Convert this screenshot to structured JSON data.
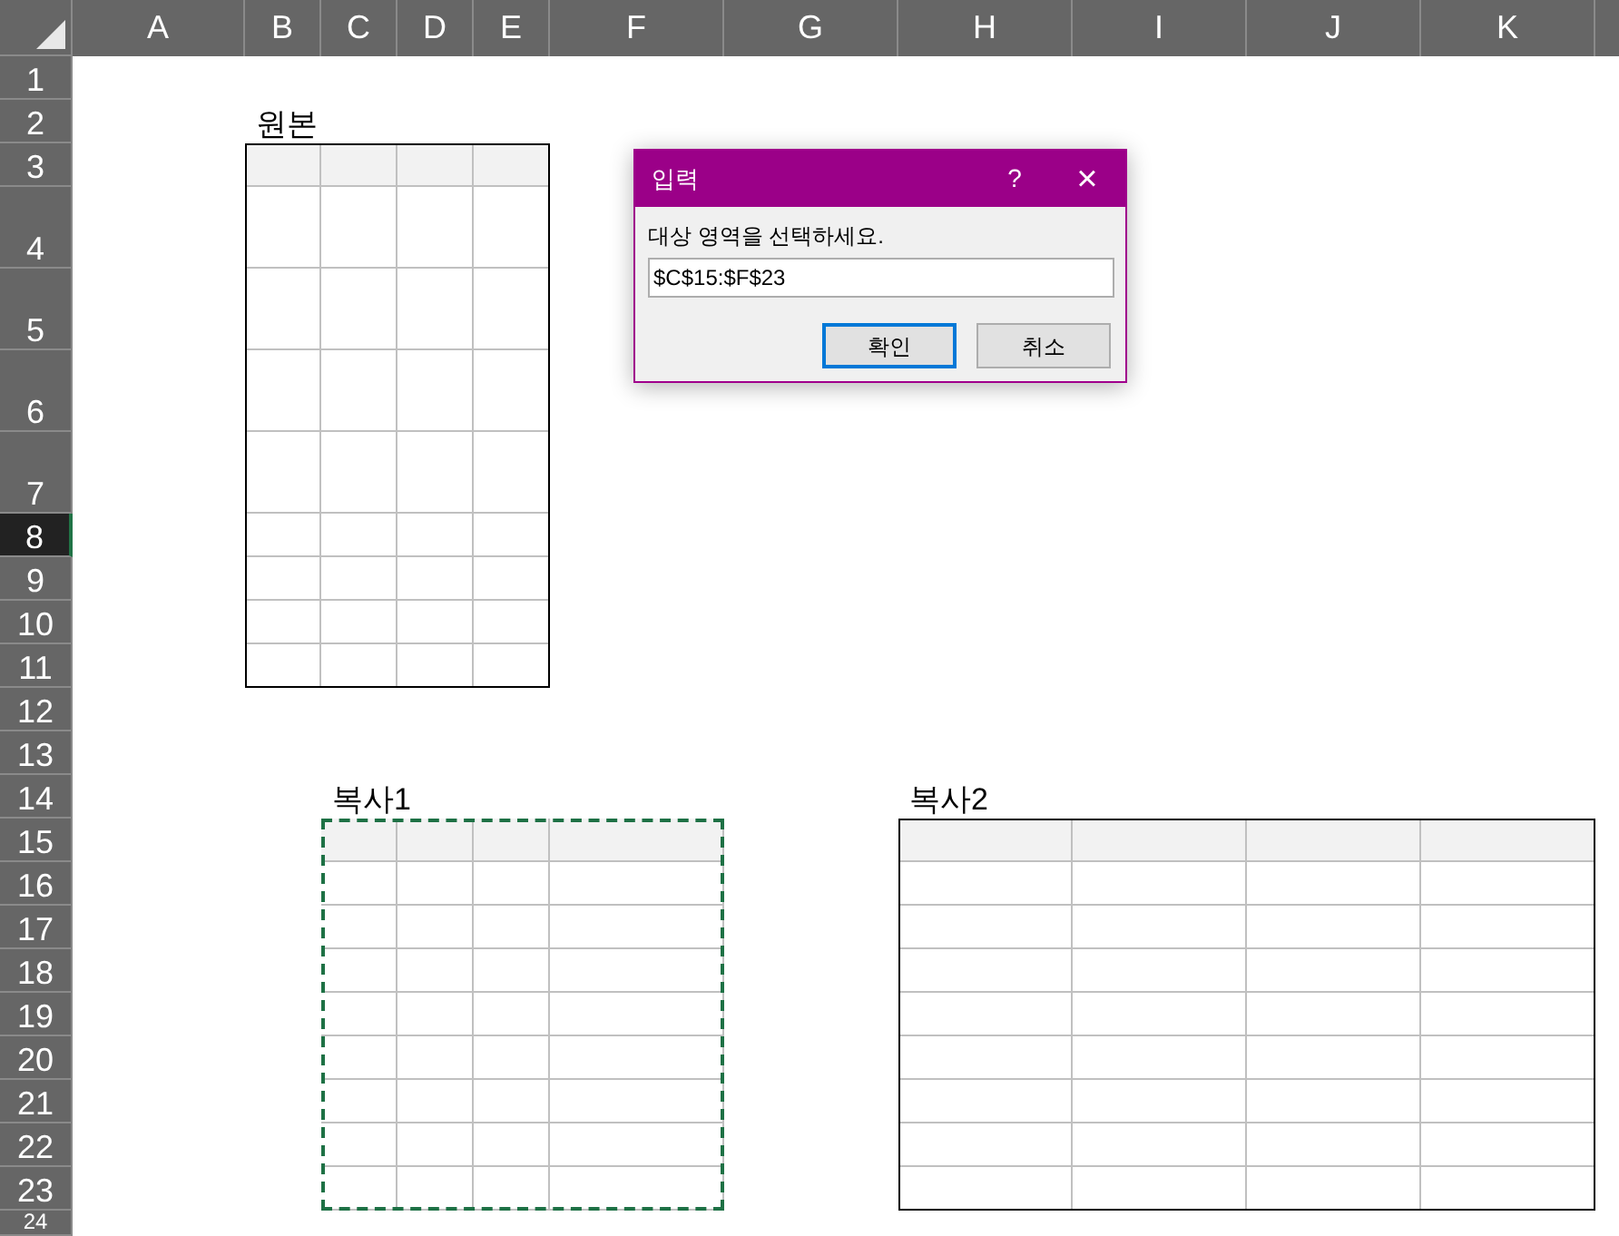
{
  "columns": [
    {
      "label": "A",
      "selected": false
    },
    {
      "label": "B",
      "selected": false
    },
    {
      "label": "C",
      "selected": false
    },
    {
      "label": "D",
      "selected": false
    },
    {
      "label": "E",
      "selected": false
    },
    {
      "label": "F",
      "selected": false
    },
    {
      "label": "G",
      "selected": false
    },
    {
      "label": "H",
      "selected": false
    },
    {
      "label": "I",
      "selected": false
    },
    {
      "label": "J",
      "selected": false
    },
    {
      "label": "K",
      "selected": false
    }
  ],
  "rows": [
    {
      "label": "1",
      "selected": false
    },
    {
      "label": "2",
      "selected": false
    },
    {
      "label": "3",
      "selected": false
    },
    {
      "label": "4",
      "selected": false
    },
    {
      "label": "5",
      "selected": false
    },
    {
      "label": "6",
      "selected": false
    },
    {
      "label": "7",
      "selected": false
    },
    {
      "label": "8",
      "selected": true
    },
    {
      "label": "9",
      "selected": false
    },
    {
      "label": "10",
      "selected": false
    },
    {
      "label": "11",
      "selected": false
    },
    {
      "label": "12",
      "selected": false
    },
    {
      "label": "13",
      "selected": false
    },
    {
      "label": "14",
      "selected": false
    },
    {
      "label": "15",
      "selected": false
    },
    {
      "label": "16",
      "selected": false
    },
    {
      "label": "17",
      "selected": false
    },
    {
      "label": "18",
      "selected": false
    },
    {
      "label": "19",
      "selected": false
    },
    {
      "label": "20",
      "selected": false
    },
    {
      "label": "21",
      "selected": false
    },
    {
      "label": "22",
      "selected": false
    },
    {
      "label": "23",
      "selected": false
    },
    {
      "label": "24",
      "selected": false
    }
  ],
  "tables": [
    {
      "title": "원본",
      "kind": "solid"
    },
    {
      "title": "복사1",
      "kind": "copy-selection"
    },
    {
      "title": "복사2",
      "kind": "solid"
    }
  ],
  "dialog": {
    "title": "입력",
    "help": "?",
    "close": "×",
    "prompt": "대상 영역을 선택하세요.",
    "value": "$C$15:$F$23",
    "buttons": [
      {
        "label": "확인",
        "default": true
      },
      {
        "label": "취소",
        "default": false
      }
    ]
  }
}
